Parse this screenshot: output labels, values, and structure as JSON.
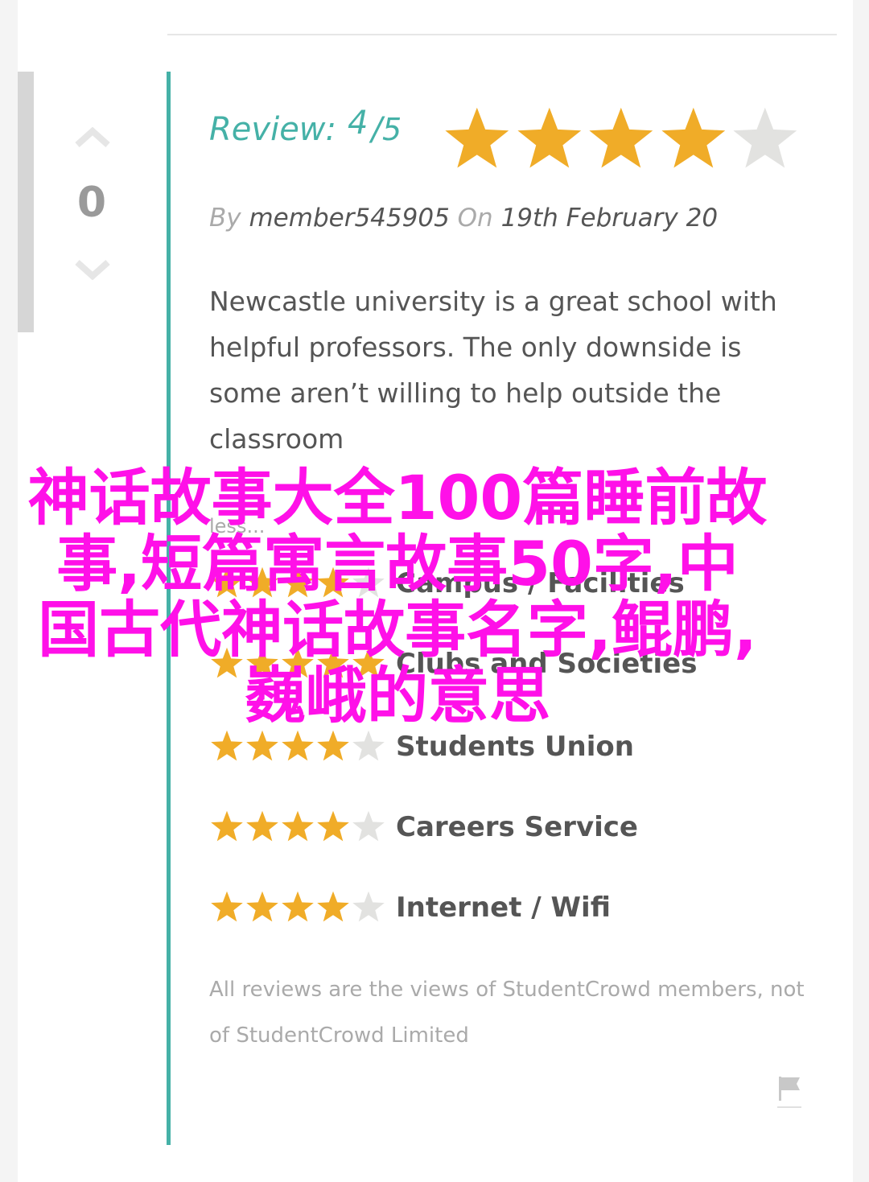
{
  "vote": {
    "up_icon": "chevron-up-icon",
    "count": "0",
    "down_icon": "chevron-down-icon"
  },
  "review": {
    "label": "Review:",
    "score": "4",
    "slash": "/",
    "out_of": "5",
    "rating": 4,
    "max_rating": 5,
    "by_prefix": "By",
    "author": "member545905",
    "on_prefix": "On",
    "date": "19th February 20",
    "body": "Newcastle university is a great school with helpful professors. The only downside is some aren’t willing to help outside the classroom",
    "less_link": "less..."
  },
  "categories": [
    {
      "label": "Campus / Facilities",
      "rating": 4
    },
    {
      "label": "Clubs and Societies",
      "rating": 5
    },
    {
      "label": "Students Union",
      "rating": 4
    },
    {
      "label": "Careers Service",
      "rating": 4
    },
    {
      "label": "Internet / Wifi",
      "rating": 4
    }
  ],
  "disclaimer": "All reviews are the views of StudentCrowd members, not of StudentCrowd Limited",
  "flag_icon": "flag-icon",
  "overlay_title": "神话故事大全100篇睡前故事,短篇寓言故事50字,中国古代神话故事名字,鲲鹏,巍峨的意思",
  "colors": {
    "accent": "#45b1a7",
    "star_filled": "#f0ac28",
    "star_empty": "#e2e2e0",
    "overlay_text": "#ff10e8"
  }
}
